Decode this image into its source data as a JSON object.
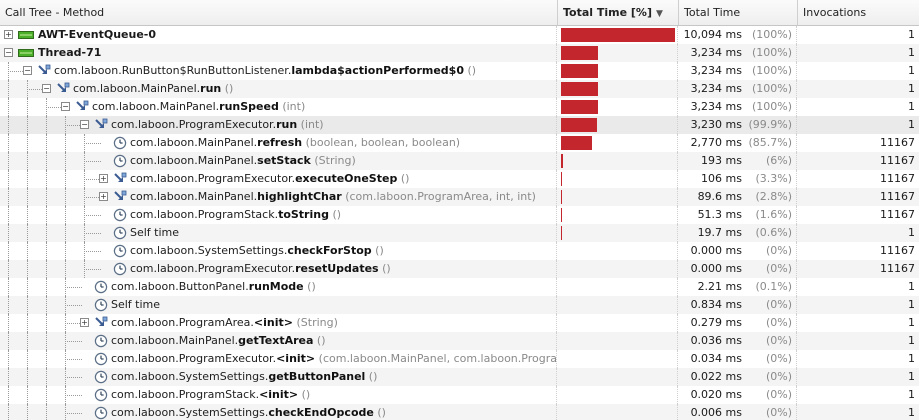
{
  "columns": {
    "method": "Call Tree - Method",
    "total_pct": "Total Time [%]",
    "total_time": "Total Time",
    "invocations": "Invocations"
  },
  "colors": {
    "bar": "#c4262e",
    "thread_icon": "#4caf2a",
    "selected_row": "#eaeaea"
  },
  "rows": [
    {
      "level": 0,
      "expander": "+",
      "icon": "thread-icon",
      "cls": "AWT-EventQueue-0",
      "method": "",
      "args": "",
      "time": "10,094 ms",
      "pct": "(100%)",
      "fraction": 1.0,
      "inv": "1"
    },
    {
      "level": 0,
      "expander": "-",
      "icon": "thread-icon",
      "cls": "Thread-71",
      "method": "",
      "args": "",
      "time": "3,234 ms",
      "pct": "(100%)",
      "fraction": 0.3204,
      "inv": "1"
    },
    {
      "level": 1,
      "expander": "-",
      "icon": "method-icon",
      "cls": "com.laboon.RunButton$RunButtonListener.",
      "method": "lambda$actionPerformed$0",
      "args": " ()",
      "time": "3,234 ms",
      "pct": "(100%)",
      "fraction": 0.3204,
      "inv": "1"
    },
    {
      "level": 2,
      "expander": "-",
      "icon": "method-icon",
      "cls": "com.laboon.MainPanel.",
      "method": "run",
      "args": " ()",
      "time": "3,234 ms",
      "pct": "(100%)",
      "fraction": 0.3204,
      "inv": "1"
    },
    {
      "level": 3,
      "expander": "-",
      "icon": "method-icon",
      "cls": "com.laboon.MainPanel.",
      "method": "runSpeed",
      "args": " (int)",
      "time": "3,234 ms",
      "pct": "(100%)",
      "fraction": 0.3204,
      "inv": "1"
    },
    {
      "level": 4,
      "expander": "-",
      "icon": "method-icon",
      "cls": "com.laboon.ProgramExecutor.",
      "method": "run",
      "args": " (int)",
      "time": "3,230 ms",
      "pct": "(99.9%)",
      "fraction": 0.32,
      "inv": "1",
      "selected": true
    },
    {
      "level": 5,
      "expander": "",
      "icon": "clock-icon",
      "cls": "com.laboon.MainPanel.",
      "method": "refresh",
      "args": " (boolean, boolean, boolean)",
      "time": "2,770 ms",
      "pct": "(85.7%)",
      "fraction": 0.2744,
      "inv": "11167"
    },
    {
      "level": 5,
      "expander": "",
      "icon": "clock-icon",
      "cls": "com.laboon.MainPanel.",
      "method": "setStack",
      "args": " (String)",
      "time": "193 ms",
      "pct": "(6%)",
      "fraction": 0.0191,
      "inv": "11167"
    },
    {
      "level": 5,
      "expander": "+",
      "icon": "method-icon",
      "cls": "com.laboon.ProgramExecutor.",
      "method": "executeOneStep",
      "args": " ()",
      "time": "106 ms",
      "pct": "(3.3%)",
      "fraction": 0.0105,
      "inv": "11167"
    },
    {
      "level": 5,
      "expander": "+",
      "icon": "method-icon",
      "cls": "com.laboon.MainPanel.",
      "method": "highlightChar",
      "args": " (com.laboon.ProgramArea, int, int)",
      "time": "89.6 ms",
      "pct": "(2.8%)",
      "fraction": 0.0089,
      "inv": "11167"
    },
    {
      "level": 5,
      "expander": "",
      "icon": "clock-icon",
      "cls": "com.laboon.ProgramStack.",
      "method": "toString",
      "args": " ()",
      "time": "51.3 ms",
      "pct": "(1.6%)",
      "fraction": 0.0051,
      "inv": "11167"
    },
    {
      "level": 5,
      "expander": "",
      "icon": "clock-icon",
      "cls": "Self time",
      "method": "",
      "args": "",
      "time": "19.7 ms",
      "pct": "(0.6%)",
      "fraction": 0.002,
      "inv": "1"
    },
    {
      "level": 5,
      "expander": "",
      "icon": "clock-icon",
      "cls": "com.laboon.SystemSettings.",
      "method": "checkForStop",
      "args": " ()",
      "time": "0.000 ms",
      "pct": "(0%)",
      "fraction": 0,
      "inv": "11167"
    },
    {
      "level": 5,
      "expander": "",
      "icon": "clock-icon",
      "cls": "com.laboon.ProgramExecutor.",
      "method": "resetUpdates",
      "args": " ()",
      "time": "0.000 ms",
      "pct": "(0%)",
      "fraction": 0,
      "inv": "11167"
    },
    {
      "level": 4,
      "expander": "",
      "icon": "clock-icon",
      "cls": "com.laboon.ButtonPanel.",
      "method": "runMode",
      "args": " ()",
      "time": "2.21 ms",
      "pct": "(0.1%)",
      "fraction": 0,
      "inv": "1"
    },
    {
      "level": 4,
      "expander": "",
      "icon": "clock-icon",
      "cls": "Self time",
      "method": "",
      "args": "",
      "time": "0.834 ms",
      "pct": "(0%)",
      "fraction": 0,
      "inv": "1"
    },
    {
      "level": 4,
      "expander": "+",
      "icon": "method-icon",
      "cls": "com.laboon.ProgramArea.",
      "method": "<init>",
      "args": " (String)",
      "time": "0.279 ms",
      "pct": "(0%)",
      "fraction": 0,
      "inv": "1"
    },
    {
      "level": 4,
      "expander": "",
      "icon": "clock-icon",
      "cls": "com.laboon.MainPanel.",
      "method": "getTextArea",
      "args": " ()",
      "time": "0.036 ms",
      "pct": "(0%)",
      "fraction": 0,
      "inv": "1"
    },
    {
      "level": 4,
      "expander": "",
      "icon": "clock-icon",
      "cls": "com.laboon.ProgramExecutor.",
      "method": "<init>",
      "args": " (com.laboon.MainPanel, com.laboon.ProgramStack, co",
      "time": "0.034 ms",
      "pct": "(0%)",
      "fraction": 0,
      "inv": "1"
    },
    {
      "level": 4,
      "expander": "",
      "icon": "clock-icon",
      "cls": "com.laboon.SystemSettings.",
      "method": "getButtonPanel",
      "args": " ()",
      "time": "0.022 ms",
      "pct": "(0%)",
      "fraction": 0,
      "inv": "1"
    },
    {
      "level": 4,
      "expander": "",
      "icon": "clock-icon",
      "cls": "com.laboon.ProgramStack.",
      "method": "<init>",
      "args": " ()",
      "time": "0.020 ms",
      "pct": "(0%)",
      "fraction": 0,
      "inv": "1"
    },
    {
      "level": 4,
      "expander": "",
      "icon": "clock-icon",
      "cls": "com.laboon.SystemSettings.",
      "method": "checkEndOpcode",
      "args": " ()",
      "time": "0.006 ms",
      "pct": "(0%)",
      "fraction": 0,
      "inv": "1"
    }
  ]
}
